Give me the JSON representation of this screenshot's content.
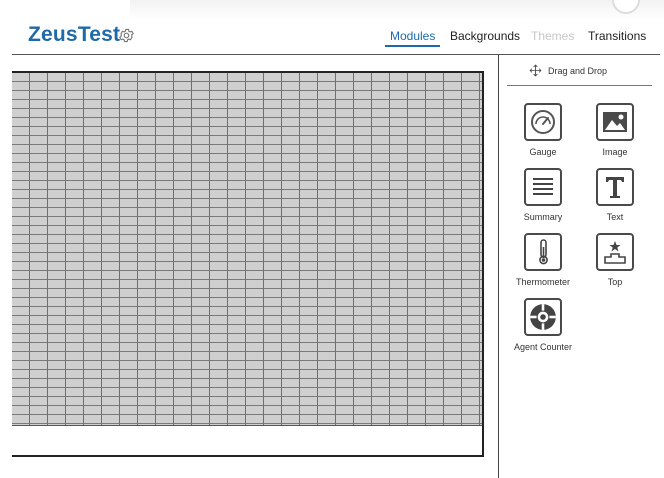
{
  "app": {
    "title": "ZeusTest"
  },
  "icons": {
    "settings": "gear-icon",
    "drag": "move-arrows-icon"
  },
  "nav": {
    "tabs": [
      {
        "label": "Modules",
        "state": "active"
      },
      {
        "label": "Backgrounds",
        "state": "normal"
      },
      {
        "label": "Themes",
        "state": "disabled"
      },
      {
        "label": "Transitions",
        "state": "normal"
      }
    ]
  },
  "panel": {
    "drag_label": "Drag and Drop",
    "modules": [
      {
        "label": "Gauge",
        "icon": "gauge-icon"
      },
      {
        "label": "Image",
        "icon": "image-icon"
      },
      {
        "label": "Summary",
        "icon": "summary-icon"
      },
      {
        "label": "Text",
        "icon": "text-icon"
      },
      {
        "label": "Thermometer",
        "icon": "thermometer-icon"
      },
      {
        "label": "Top",
        "icon": "podium-icon"
      },
      {
        "label": "Agent Counter",
        "icon": "agent-counter-icon"
      }
    ]
  },
  "colors": {
    "brand": "#1e6aa8",
    "grid_fill": "#cfcfcf",
    "grid_line": "#6f6f6f",
    "disabled": "#c8c8c8"
  }
}
